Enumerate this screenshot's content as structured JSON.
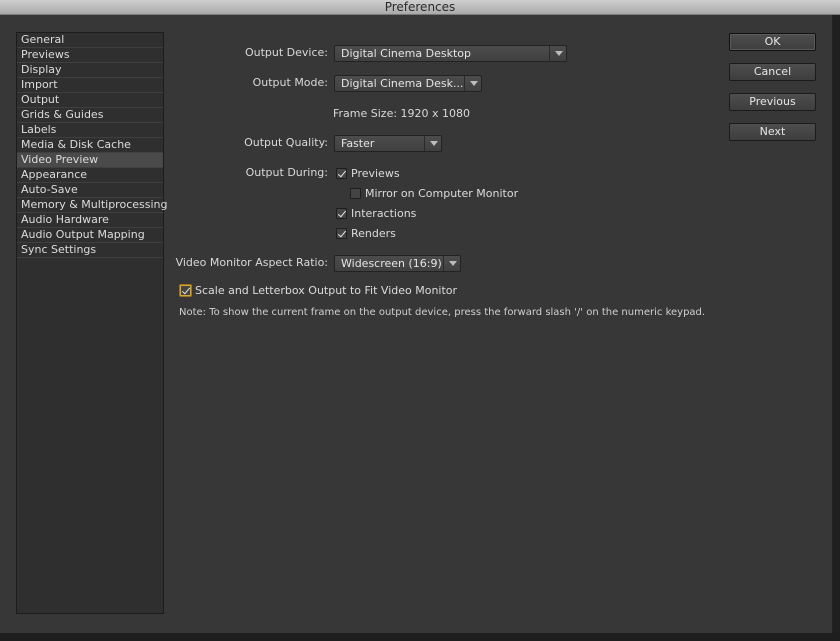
{
  "window": {
    "title": "Preferences"
  },
  "sidebar": {
    "items": [
      {
        "label": "General",
        "active": false
      },
      {
        "label": "Previews",
        "active": false
      },
      {
        "label": "Display",
        "active": false
      },
      {
        "label": "Import",
        "active": false
      },
      {
        "label": "Output",
        "active": false
      },
      {
        "label": "Grids & Guides",
        "active": false
      },
      {
        "label": "Labels",
        "active": false
      },
      {
        "label": "Media & Disk Cache",
        "active": false
      },
      {
        "label": "Video Preview",
        "active": true
      },
      {
        "label": "Appearance",
        "active": false
      },
      {
        "label": "Auto-Save",
        "active": false
      },
      {
        "label": "Memory & Multiprocessing",
        "active": false
      },
      {
        "label": "Audio Hardware",
        "active": false
      },
      {
        "label": "Audio Output Mapping",
        "active": false
      },
      {
        "label": "Sync Settings",
        "active": false
      }
    ]
  },
  "form": {
    "output_device_label": "Output Device:",
    "output_device_value": "Digital Cinema Desktop",
    "output_mode_label": "Output Mode:",
    "output_mode_value": "Digital Cinema Desk...",
    "frame_size_text": "Frame Size:  1920 x 1080",
    "output_quality_label": "Output Quality:",
    "output_quality_value": "Faster",
    "output_during_label": "Output During:",
    "previews_label": "Previews",
    "previews_checked": true,
    "mirror_label": "Mirror on Computer Monitor",
    "mirror_checked": false,
    "interactions_label": "Interactions",
    "interactions_checked": true,
    "renders_label": "Renders",
    "renders_checked": true,
    "aspect_ratio_label": "Video Monitor Aspect Ratio:",
    "aspect_ratio_value": "Widescreen (16:9)",
    "scale_label": "Scale and Letterbox Output to Fit Video Monitor",
    "scale_checked": true,
    "note": "Note: To show the current frame on the output device, press the forward slash '/' on the numeric keypad."
  },
  "buttons": {
    "ok": "OK",
    "cancel": "Cancel",
    "previous": "Previous",
    "next": "Next"
  },
  "colors": {
    "focus_accent": "#d8a831"
  }
}
